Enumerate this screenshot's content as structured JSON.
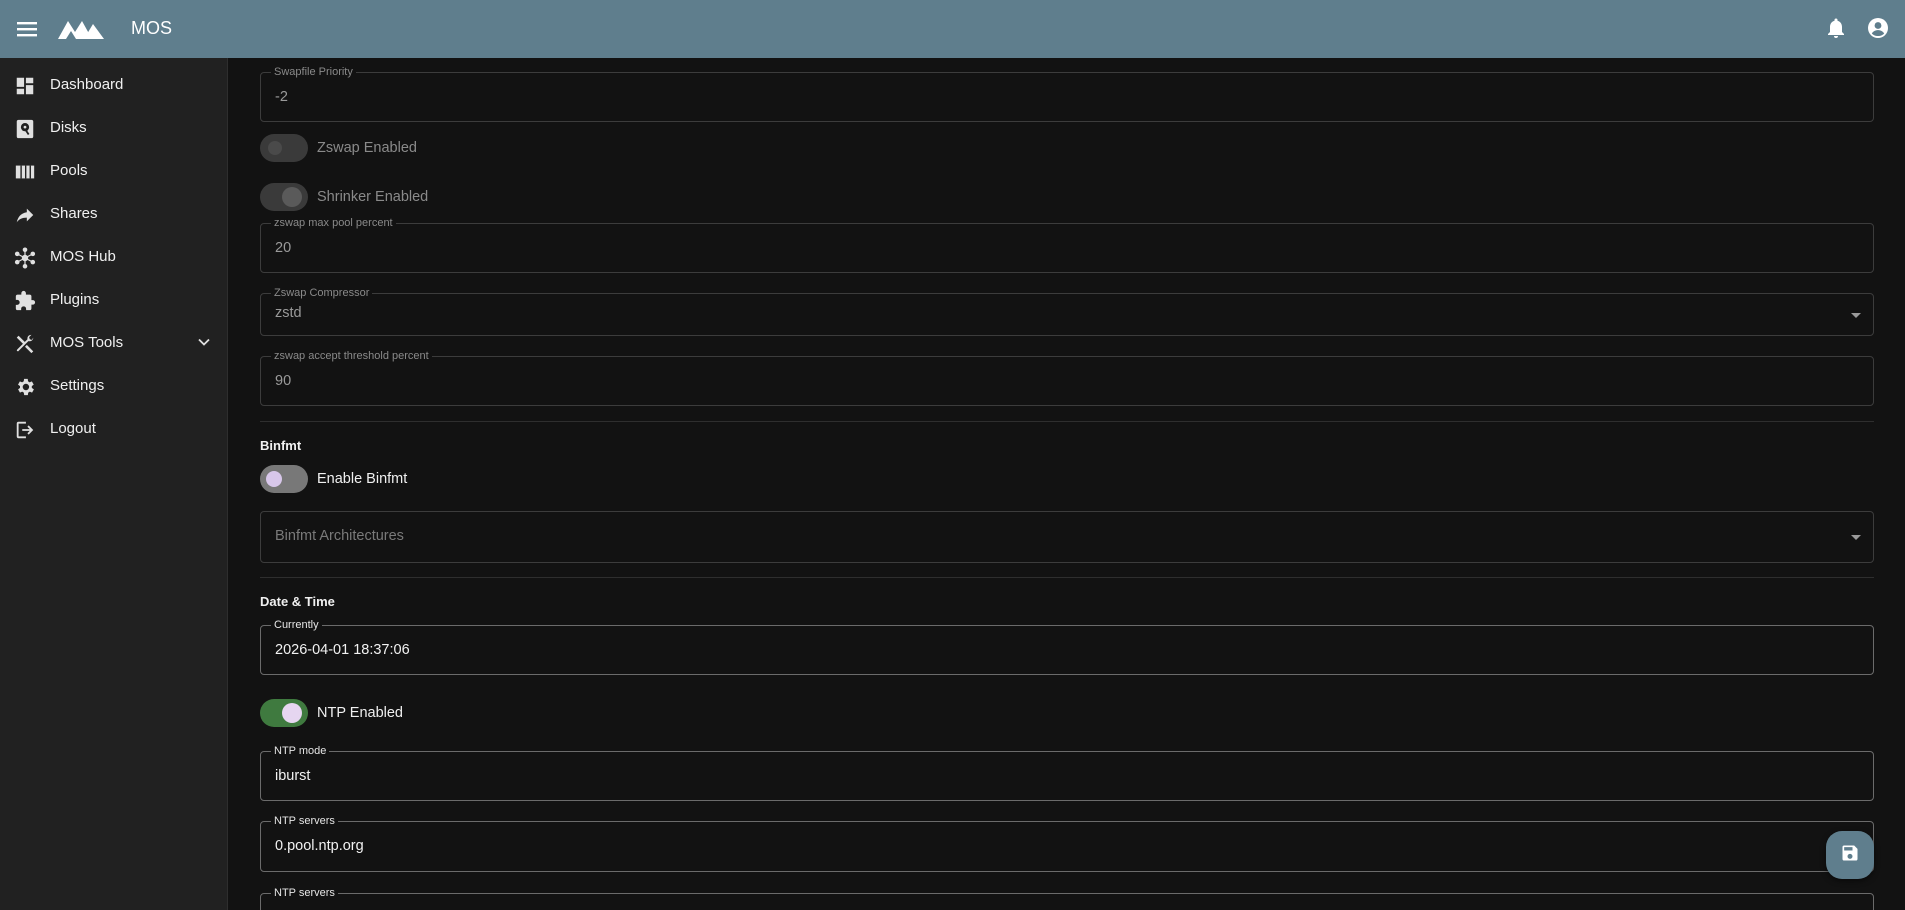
{
  "app": {
    "title": "MOS"
  },
  "sidebar": {
    "items": [
      {
        "label": "Dashboard",
        "icon": "dashboard-icon"
      },
      {
        "label": "Disks",
        "icon": "disk-icon"
      },
      {
        "label": "Pools",
        "icon": "pools-icon"
      },
      {
        "label": "Shares",
        "icon": "share-icon"
      },
      {
        "label": "MOS Hub",
        "icon": "hub-icon"
      },
      {
        "label": "Plugins",
        "icon": "puzzle-icon"
      },
      {
        "label": "MOS Tools",
        "icon": "tools-icon",
        "expandable": true
      },
      {
        "label": "Settings",
        "icon": "gear-icon"
      },
      {
        "label": "Logout",
        "icon": "logout-icon"
      }
    ]
  },
  "swap": {
    "swapfile_priority": {
      "label": "Swapfile Priority",
      "value": "-2"
    },
    "zswap_enabled": {
      "label": "Zswap Enabled",
      "on": false,
      "disabled": true
    },
    "shrinker_enabled": {
      "label": "Shrinker Enabled",
      "on": true,
      "disabled": true
    },
    "max_pool_percent": {
      "label": "zswap max pool percent",
      "value": "20"
    },
    "compressor": {
      "label": "Zswap Compressor",
      "value": "zstd"
    },
    "accept_threshold": {
      "label": "zswap accept threshold percent",
      "value": "90"
    }
  },
  "binfmt": {
    "section_title": "Binfmt",
    "enable": {
      "label": "Enable Binfmt",
      "on": false
    },
    "architectures": {
      "placeholder": "Binfmt Architectures"
    }
  },
  "datetime": {
    "section_title": "Date & Time",
    "currently": {
      "label": "Currently",
      "value": "2026-04-01 18:37:06"
    },
    "ntp_enabled": {
      "label": "NTP Enabled",
      "on": true
    },
    "ntp_mode": {
      "label": "NTP mode",
      "value": "iburst"
    },
    "ntp_servers": [
      {
        "label": "NTP servers",
        "value": "0.pool.ntp.org"
      },
      {
        "label": "NTP servers",
        "value": ""
      }
    ]
  },
  "colors": {
    "topbar": "#5f7e8d",
    "sidebar": "#212121",
    "background": "#121212",
    "toggle_on": "#3f7a3f"
  }
}
